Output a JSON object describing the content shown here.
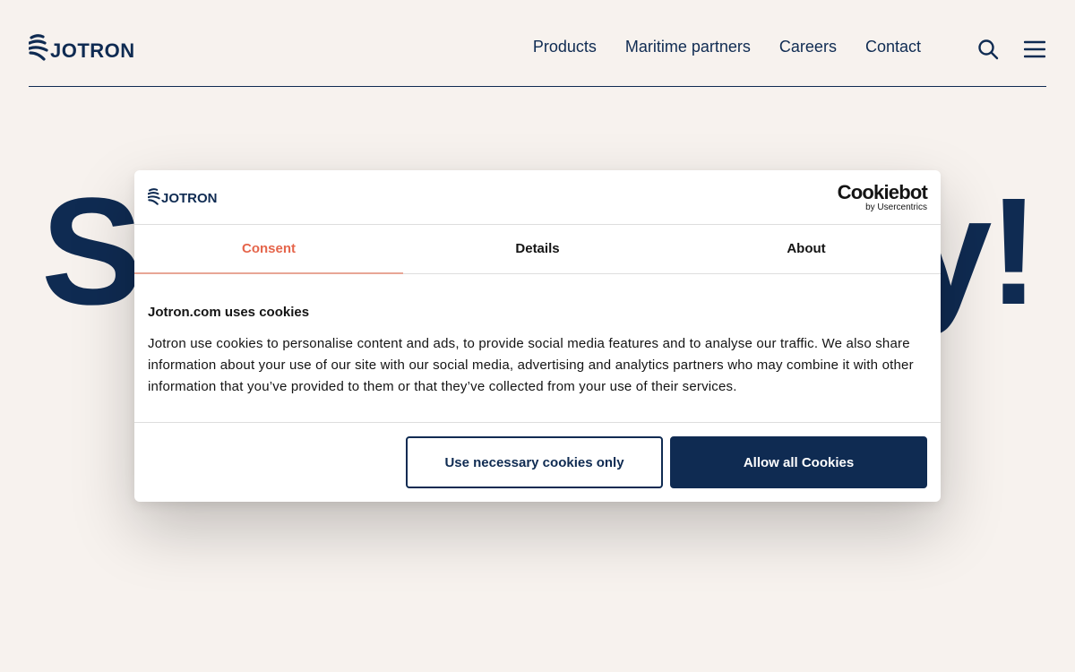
{
  "header": {
    "brand": "JOTRON",
    "nav": [
      "Products",
      "Maritime partners",
      "Careers",
      "Contact"
    ],
    "icons": {
      "search": "search-icon",
      "menu": "hamburger-menu-icon"
    }
  },
  "hero": {
    "left_text": "S",
    "right_text": "y!"
  },
  "cookie_dialog": {
    "brand": "JOTRON",
    "provider": {
      "name": "Cookiebot",
      "by": "by Usercentrics"
    },
    "tabs": [
      "Consent",
      "Details",
      "About"
    ],
    "active_tab": "Consent",
    "heading": "Jotron.com uses cookies",
    "body": "Jotron use cookies to personalise content and ads, to provide social media features and to analyse our traffic. We also share information about your use of our site with our social media, advertising and analytics partners who may combine it with other information that you’ve provided to them or that they’ve collected from your use of their services.",
    "buttons": {
      "necessary": "Use necessary cookies only",
      "allow_all": "Allow all Cookies"
    }
  },
  "colors": {
    "navy": "#0f2b52",
    "accent": "#e5654b",
    "background": "#f7f2ee"
  }
}
